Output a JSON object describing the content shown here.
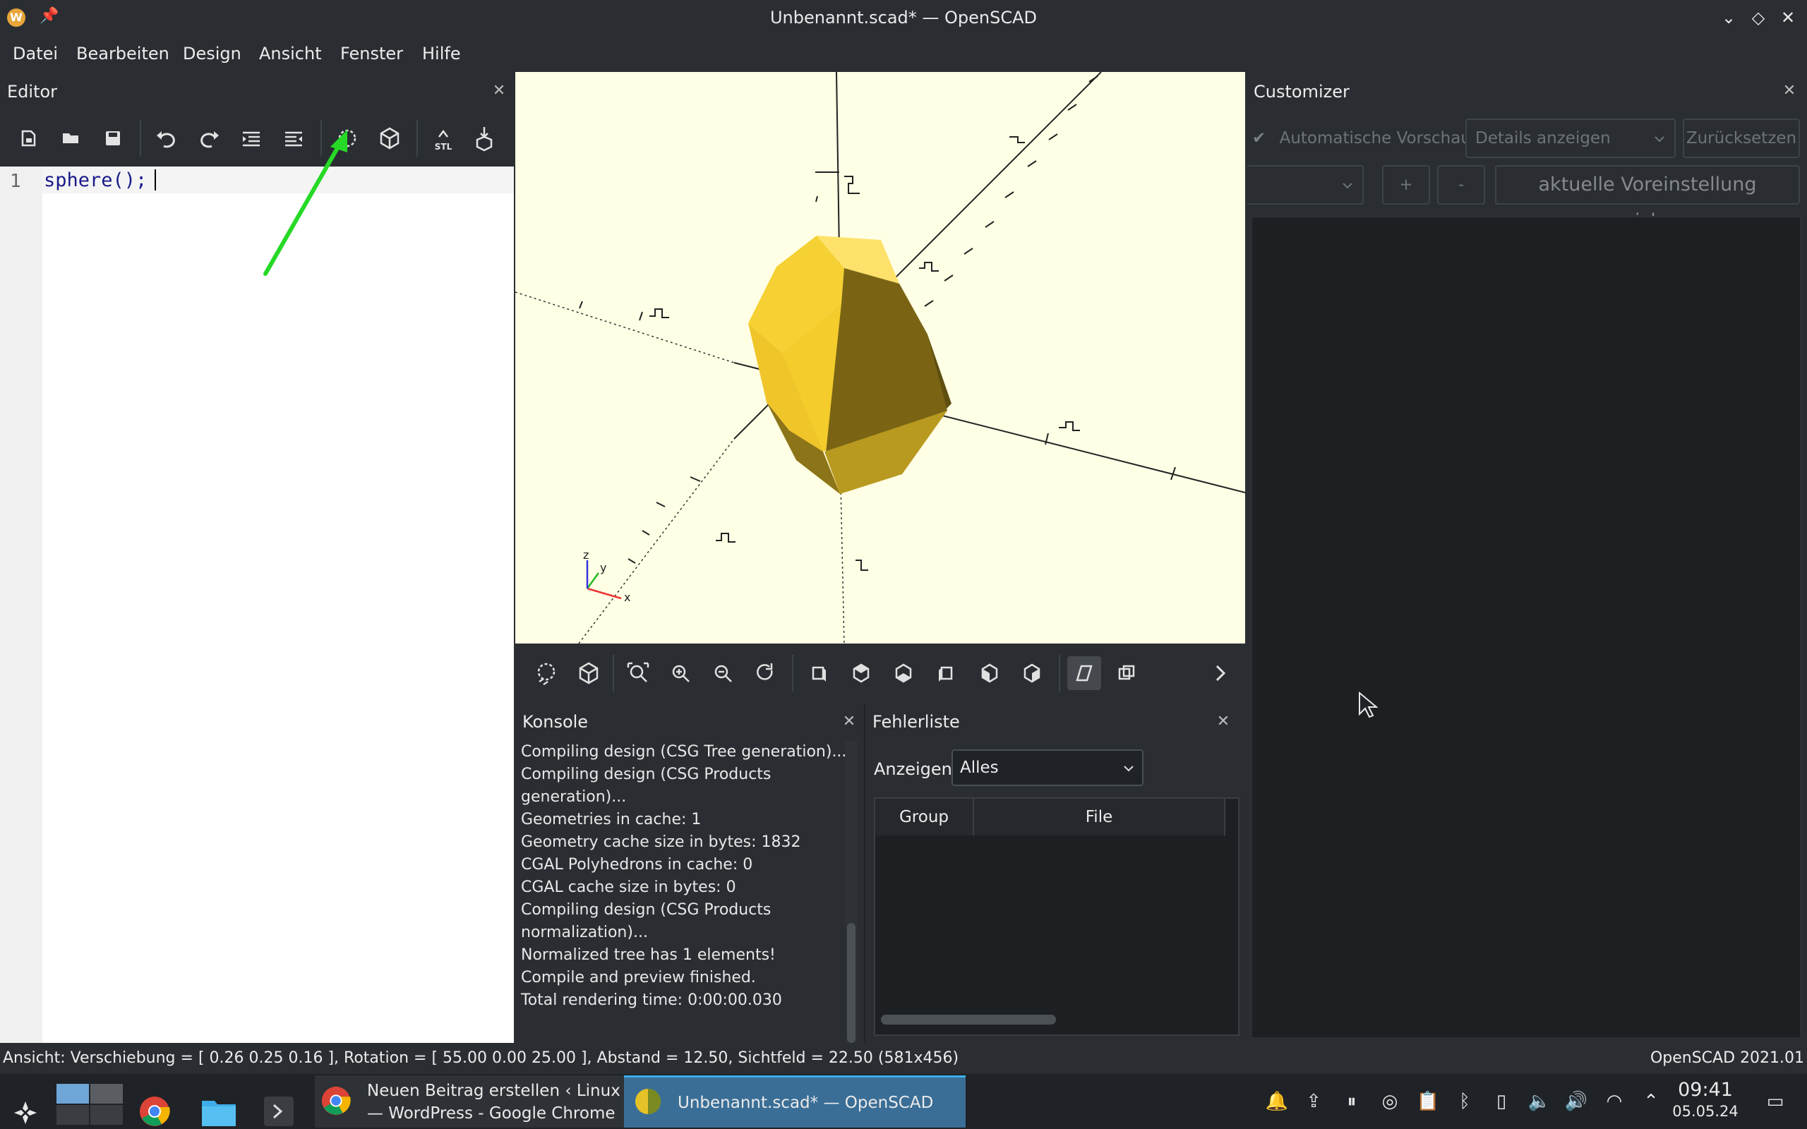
{
  "window": {
    "title": "Unbenannt.scad* — OpenSCAD"
  },
  "menu": [
    "Datei",
    "Bearbeiten",
    "Design",
    "Ansicht",
    "Fenster",
    "Hilfe"
  ],
  "editor": {
    "title": "Editor",
    "line_number": "1",
    "code": "sphere();"
  },
  "customizer": {
    "title": "Customizer",
    "auto_preview": "Automatische Vorschau",
    "details_select": "Details anzeigen",
    "reset": "Zurücksetzen",
    "plus": "+",
    "minus": "-",
    "save_preset": "aktuelle Voreinstellung speichern"
  },
  "console": {
    "title": "Konsole",
    "lines": [
      "Compiling design (CSG Tree generation)...",
      "Compiling design (CSG Products",
      "generation)...",
      "Geometries in cache: 1",
      "Geometry cache size in bytes: 1832",
      "CGAL Polyhedrons in cache: 0",
      "CGAL cache size in bytes: 0",
      "Compiling design (CSG Products",
      "normalization)...",
      "Normalized tree has 1 elements!",
      "Compile and preview finished.",
      "Total rendering time: 0:00:00.030"
    ]
  },
  "errors": {
    "title": "Fehlerliste",
    "show_label": "Anzeigen",
    "filter_value": "Alles",
    "columns": [
      "Group",
      "File"
    ]
  },
  "viewport": {
    "axis_labels": {
      "x": "x",
      "y": "y",
      "z": "z"
    },
    "colors": {
      "background": "#ffffe5",
      "object_light": "#f8d33a",
      "object_dark": "#7a6414"
    }
  },
  "status": {
    "view": "Ansicht: Verschiebung = [ 0.26 0.25 0.16 ], Rotation = [ 55.00 0.00 25.00 ], Abstand = 12.50, Sichtfeld = 22.50 (581x456)",
    "version": "OpenSCAD 2021.01"
  },
  "taskbar": {
    "chrome_task_line1": "Neuen Beitrag erstellen ‹ Linux-Bibel",
    "chrome_task_line2": "— WordPress - Google Chrome",
    "openscad_task": "Unbenannt.scad* — OpenSCAD",
    "time": "09:41",
    "date": "05.05.24"
  }
}
